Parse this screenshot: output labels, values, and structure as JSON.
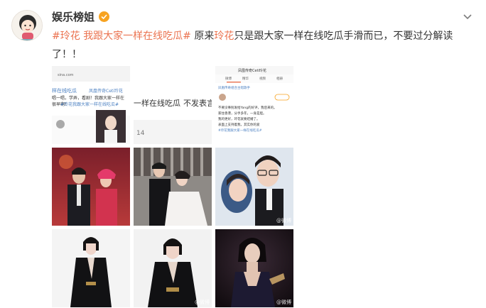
{
  "post": {
    "author": "娱乐榜姐",
    "text": {
      "topic1": "#玲花",
      "topic2": "我跟大家一样在线吃瓜#",
      "part1": " 原来",
      "highlight": "玲花",
      "part2": "只是跟大家一样在线吃瓜手滑而已，不要过分解读了！！"
    }
  },
  "images": {
    "img1": {
      "source": "sina.com",
      "line1": "样在线吃瓜",
      "line2": "凤凰传奇Ceti玲花",
      "line3": "唱一唱，学弄，看剧！我跟大家一样在",
      "line4": "很早啊！",
      "line5": "#玲花我跟大家一样在线吃瓜#"
    },
    "img2": {
      "line1": "一样在线吃瓜",
      "line2": "不发表言",
      "count": "14"
    },
    "img3": {
      "title": "凤凰传奇Ceti玲花",
      "tabs": [
        "微博",
        "精华",
        "视频",
        "相册"
      ],
      "desc": "凤凰传奇组合主唱歌手",
      "body1": "不要没事别发给Yang的好评，我后来的。",
      "body2": "家住香港，分手多年，一身是胆。",
      "body3": "我的更好，玲花就要结婚了。",
      "body4": "表面上支持着我，其实你的爱",
      "body5": "#玲花我跟大家一样在线吃瓜#"
    },
    "watermark": "@微博"
  },
  "colors": {
    "accent": "#eb7350",
    "badge": "#f7a321"
  },
  "icons": [
    "chevron-down-icon",
    "verified-badge-icon"
  ]
}
